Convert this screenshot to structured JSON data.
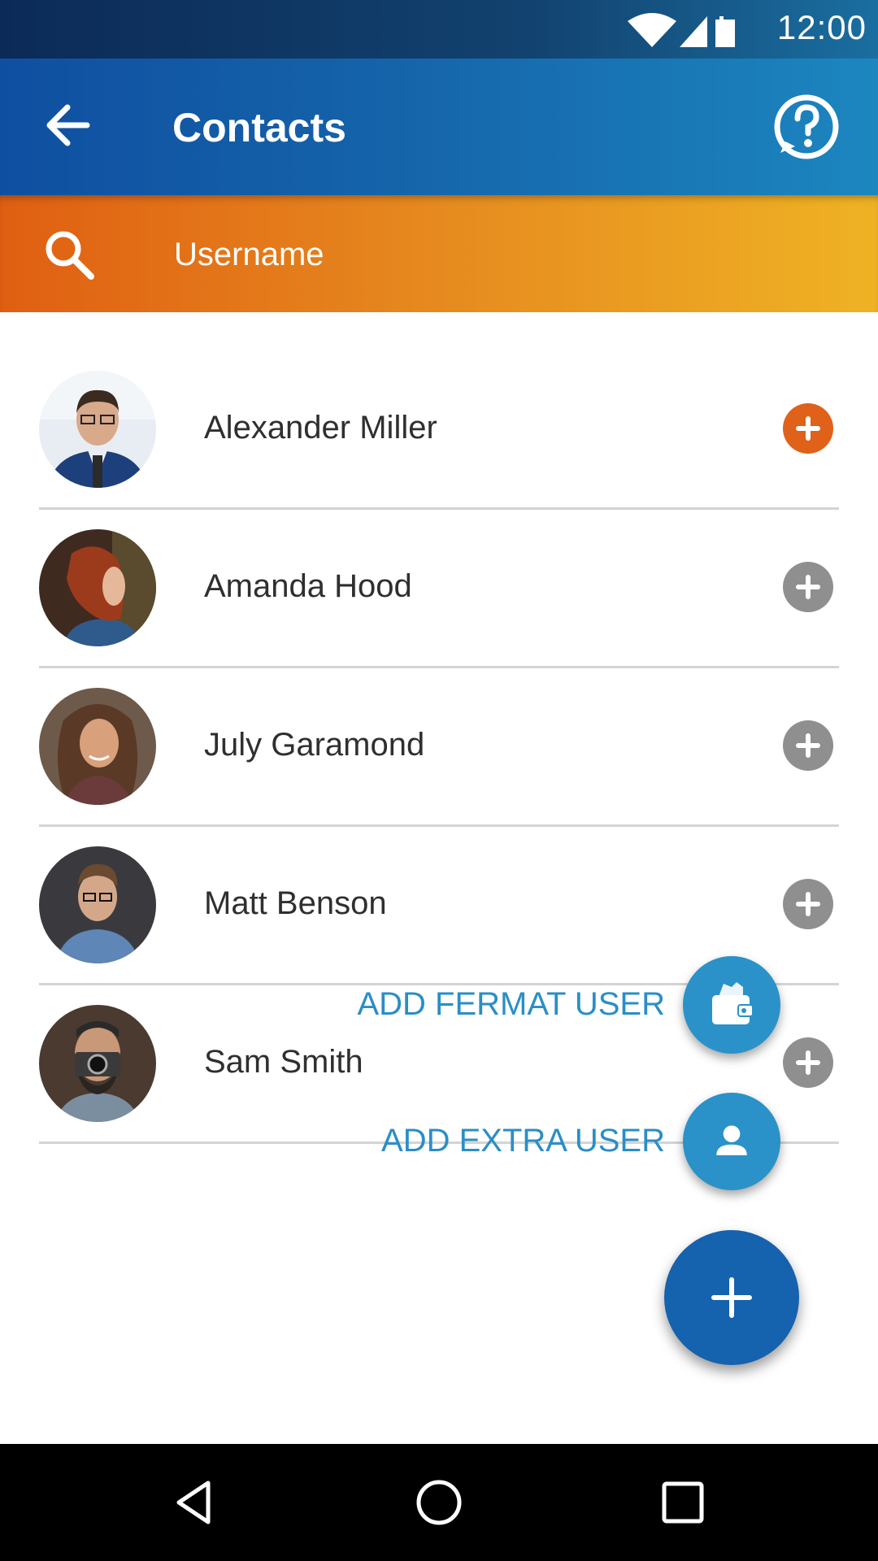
{
  "status_bar": {
    "time": "12:00",
    "icons": [
      "wifi-icon",
      "signal-icon",
      "battery-icon"
    ]
  },
  "app_bar": {
    "title": "Contacts",
    "back_icon": "arrow-back-icon",
    "help_icon": "help-icon"
  },
  "search": {
    "placeholder": "Username",
    "value": ""
  },
  "contacts": [
    {
      "name": "Alexander Miller",
      "add_active": true
    },
    {
      "name": "Amanda Hood",
      "add_active": false
    },
    {
      "name": "July Garamond",
      "add_active": false
    },
    {
      "name": "Matt Benson",
      "add_active": false
    },
    {
      "name": "Sam Smith",
      "add_active": false
    }
  ],
  "fab_menu": {
    "add_fermat_user": "ADD FERMAT USER",
    "add_extra_user": "ADD EXTRA USER"
  },
  "colors": {
    "accent_orange": "#e0611a",
    "inactive_gray": "#8f8f8f",
    "fab_blue": "#1562ae",
    "mini_fab_blue": "#2a92c9",
    "label_blue": "#2a8ec6"
  }
}
